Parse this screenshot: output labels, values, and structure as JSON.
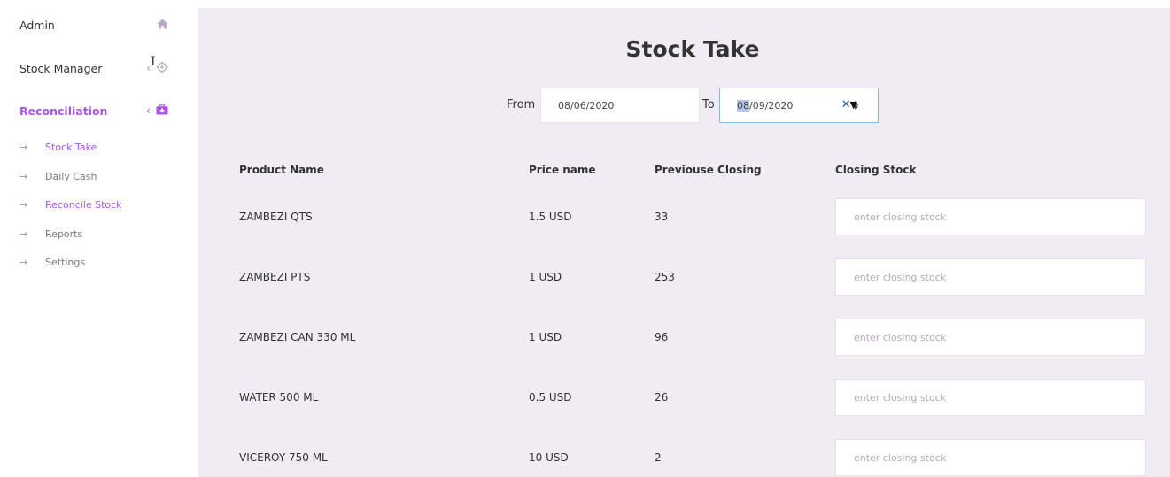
{
  "sidebar": {
    "admin": {
      "label": "Admin",
      "icon": "home-icon"
    },
    "stock_manager": {
      "label": "Stock Manager",
      "chevron": "‹",
      "icon": "target-icon"
    },
    "reconciliation": {
      "label": "Reconciliation",
      "chevron": "‹",
      "icon": "medkit-icon"
    },
    "sub_items": [
      {
        "label": "Stock Take",
        "arrow": "→",
        "active": true
      },
      {
        "label": "Daily Cash",
        "arrow": "→"
      },
      {
        "label": "Reconcile Stock",
        "arrow": "→",
        "active": true
      },
      {
        "label": "Reports",
        "arrow": "→"
      },
      {
        "label": "Settings",
        "arrow": "→"
      }
    ]
  },
  "main": {
    "title": "Stock Take",
    "from_label": "From",
    "from_date": "08/06/2020",
    "to_label": "To",
    "to_date_selected": "08",
    "to_date_rest": "/09/2020",
    "clear_glyph": "✕",
    "drop_glyph": "▼",
    "headers": {
      "product": "Product Name",
      "price": "Price name",
      "previous": "Previouse Closing",
      "closing": "Closing Stock"
    },
    "rows": [
      {
        "product": "ZAMBEZI QTS",
        "price": "1.5 USD",
        "previous": "33",
        "closing_placeholder": "enter closing stock"
      },
      {
        "product": "ZAMBEZI PTS",
        "price": "1 USD",
        "previous": "253",
        "closing_placeholder": "enter closing stock"
      },
      {
        "product": "ZAMBEZI CAN 330 ML",
        "price": "1 USD",
        "previous": "96",
        "closing_placeholder": "enter closing stock"
      },
      {
        "product": "WATER 500 ML",
        "price": "0.5 USD",
        "previous": "26",
        "closing_placeholder": "enter closing stock"
      },
      {
        "product": "VICEROY 750 ML",
        "price": "10 USD",
        "previous": "2",
        "closing_placeholder": "enter closing stock"
      }
    ]
  },
  "colors": {
    "accent": "#a855e6",
    "main_bg": "#f1ecf3",
    "focus_border": "#8fb7e6"
  }
}
